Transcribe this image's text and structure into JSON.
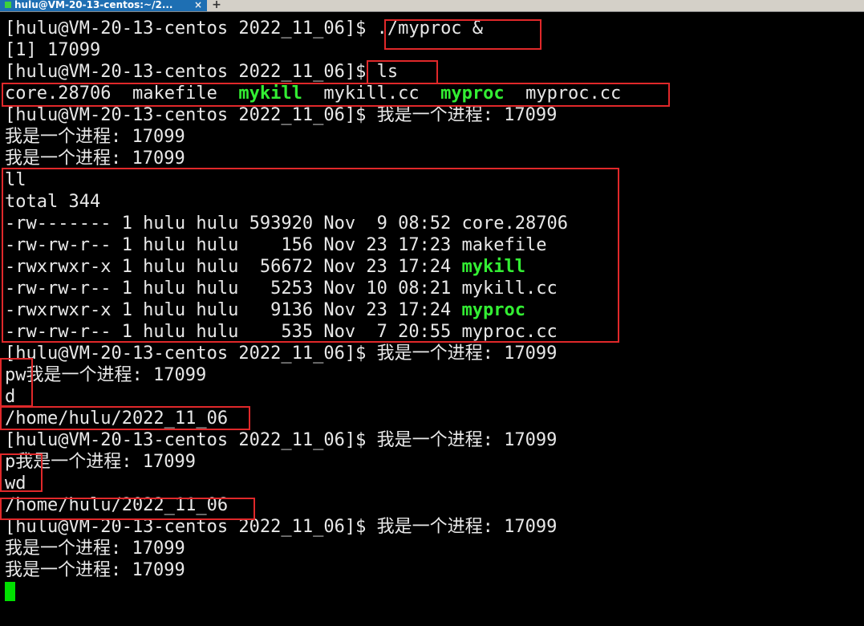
{
  "tab": {
    "title": "hulu@VM-20-13-centos:~/2...",
    "close": "×",
    "new_tab": "+"
  },
  "prompt": "[hulu@VM-20-13-centos 2022_11_06]$ ",
  "lines": {
    "l01": "./myproc &",
    "l02": "[1] 17099",
    "l03": "ls",
    "l04": {
      "core": "core.28706  ",
      "makefile": "makefile  ",
      "mykill": "mykill",
      "sep1": "  ",
      "mykill_cc": "mykill.cc  ",
      "myproc": "myproc",
      "sep2": "  ",
      "myproc_cc": "myproc.cc"
    },
    "l05": "我是一个进程: 17099",
    "l06": "我是一个进程: 17099",
    "l07": "我是一个进程: 17099",
    "l08": "ll",
    "l09": "total 344",
    "ll_rows": [
      {
        "text": "-rw------- 1 hulu hulu 593920 Nov  9 08:52 ",
        "name": "core.28706"
      },
      {
        "text": "-rw-rw-r-- 1 hulu hulu    156 Nov 23 17:23 ",
        "name": "makefile"
      },
      {
        "text": "-rwxrwxr-x 1 hulu hulu  56672 Nov 23 17:24 ",
        "name": "mykill"
      },
      {
        "text": "-rw-rw-r-- 1 hulu hulu   5253 Nov 10 08:21 ",
        "name": "mykill.cc"
      },
      {
        "text": "-rwxrwxr-x 1 hulu hulu   9136 Nov 23 17:24 ",
        "name": "myproc"
      },
      {
        "text": "-rw-rw-r-- 1 hulu hulu    535 Nov  7 20:55 ",
        "name": "myproc.cc"
      }
    ],
    "l16": "我是一个进程: 17099",
    "l17": "pw我是一个进程: 17099",
    "l18": "d",
    "l19": "/home/hulu/2022_11_06",
    "l20": "我是一个进程: 17099",
    "l21": "p我是一个进程: 17099",
    "l22": "wd",
    "l23": "/home/hulu/2022_11_06",
    "l24": "我是一个进程: 17099",
    "l25": "我是一个进程: 17099",
    "l26": "我是一个进程: 17099"
  },
  "colors": {
    "background": "#000000",
    "text": "#e8e8e8",
    "executable": "#33ee33",
    "highlight_box": "#e0282a",
    "cursor": "#00e000",
    "tab_active": "#1e6fb3"
  }
}
